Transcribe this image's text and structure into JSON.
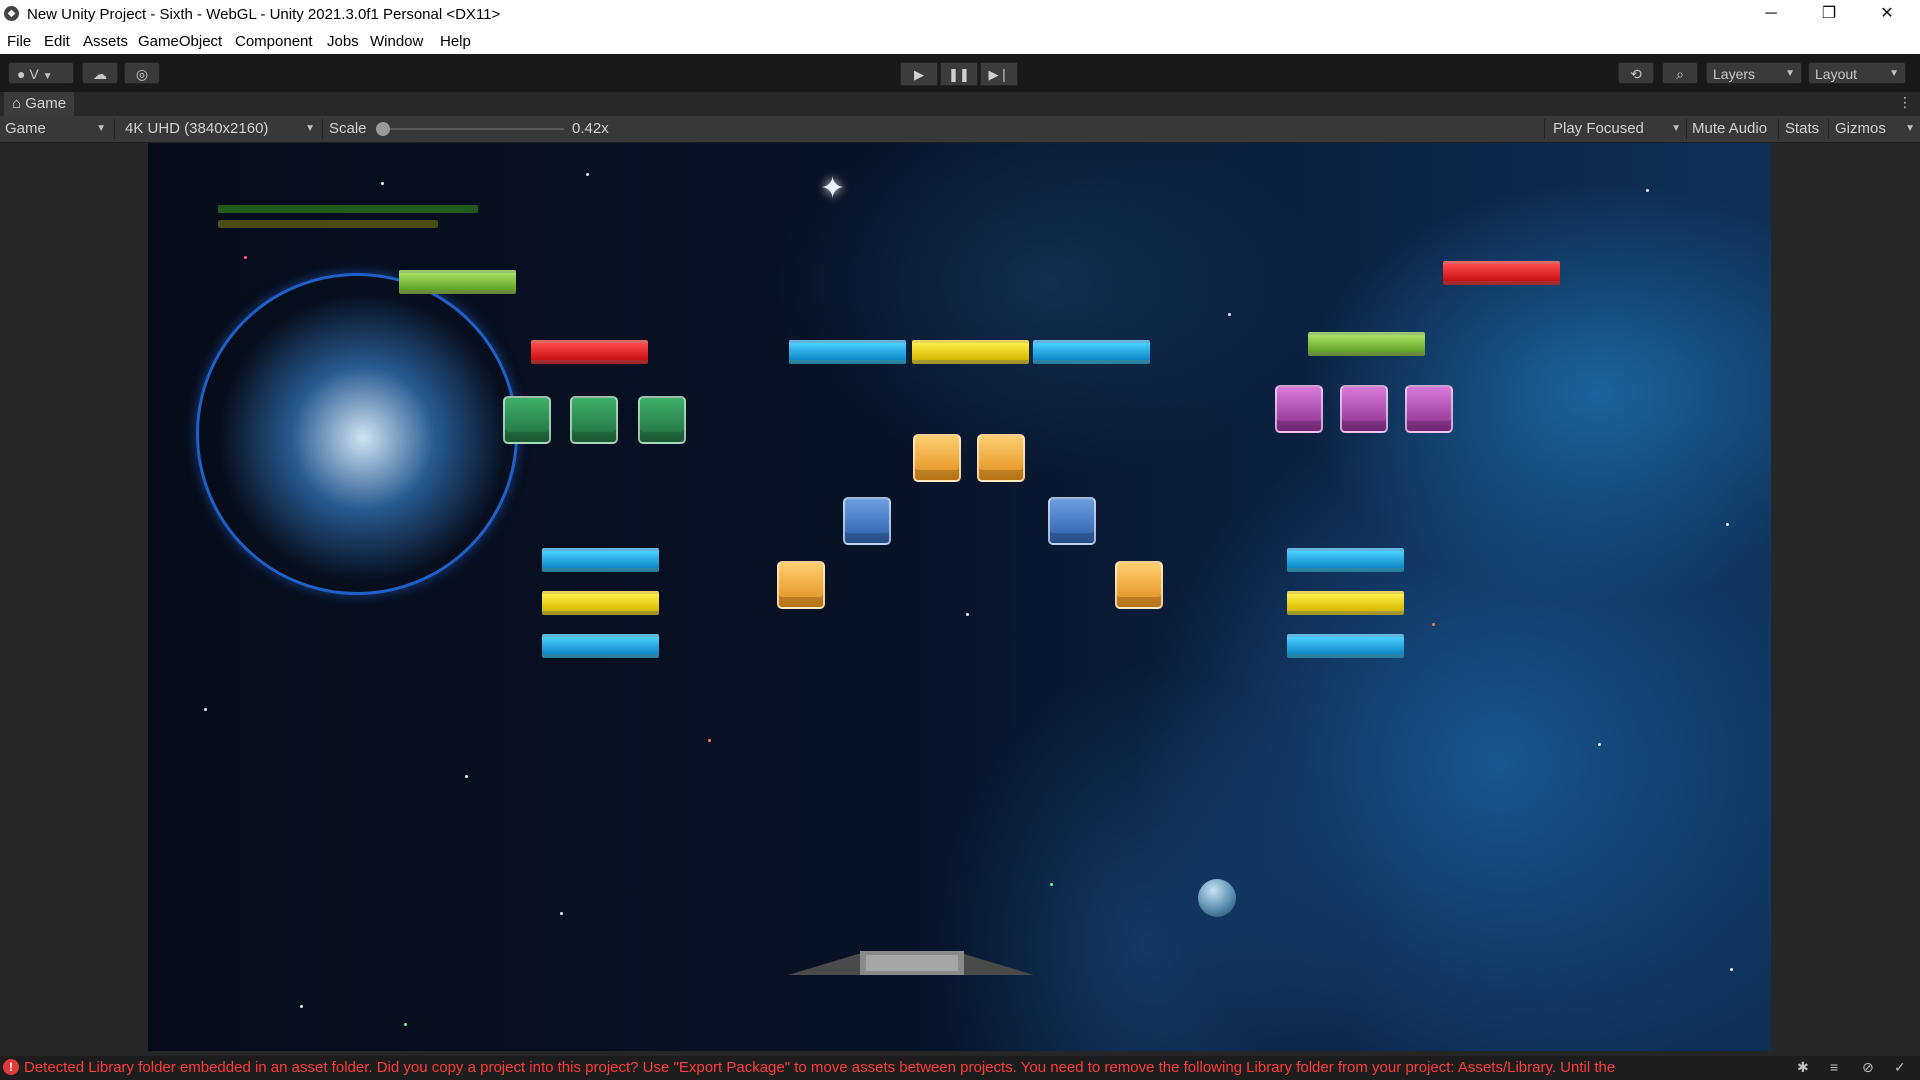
{
  "window": {
    "title": "New Unity Project - Sixth - WebGL - Unity 2021.3.0f1 Personal <DX11>",
    "minimize": "─",
    "restore": "❐",
    "close": "✕"
  },
  "menu": [
    "File",
    "Edit",
    "Assets",
    "GameObject",
    "Component",
    "Jobs",
    "Window",
    "Help"
  ],
  "toolbar": {
    "account_label": "V",
    "layers_label": "Layers",
    "layout_label": "Layout",
    "play_icon": "play-icon",
    "pause_icon": "pause-icon",
    "step_icon": "step-icon"
  },
  "tab": {
    "label": "Game"
  },
  "game_toolbar": {
    "display": "Game",
    "resolution": "4K UHD (3840x2160)",
    "scale_label": "Scale",
    "scale_value": "0.42x",
    "play_mode": "Play Focused",
    "mute": "Mute Audio",
    "stats": "Stats",
    "gizmos": "Gizmos"
  },
  "game": {
    "hud_bars": [
      {
        "color": "#1e5c1e"
      },
      {
        "color": "#4a4a12"
      }
    ],
    "bricks": {
      "long": [
        "green",
        "red",
        "blue",
        "yellow",
        "blue",
        "red",
        "green",
        "blue",
        "yellow",
        "blue",
        "blue",
        "yellow",
        "blue"
      ],
      "square": [
        "green",
        "green",
        "green",
        "orange",
        "orange",
        "blue",
        "blue",
        "orange",
        "orange",
        "purple",
        "purple",
        "purple"
      ]
    }
  },
  "status": {
    "message": "Detected Library folder embedded in an asset folder. Did you copy a project into this project? Use \"Export Package\" to move assets between projects. You need to remove the following Library folder from your project: Assets/Library. Until the"
  },
  "colors": {
    "accent_error": "#ff3b3b",
    "editor_bg": "#191919"
  }
}
